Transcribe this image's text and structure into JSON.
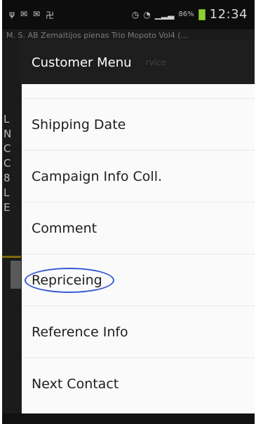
{
  "status_bar": {
    "battery_percent": "86%",
    "time": "12:34",
    "left_icons": [
      "usb-icon",
      "email-icon",
      "email-icon",
      "notification-icon"
    ],
    "right_icons": [
      "alarm-icon",
      "wifi-icon",
      "signal-icon",
      "battery-icon"
    ]
  },
  "background": {
    "title": "M. S. AB Zemaitijos pienas Trio Mopoto Vol4 (...",
    "left_letters": [
      "L",
      "N",
      "C",
      "C",
      "8",
      "L",
      "E"
    ]
  },
  "dialog": {
    "title": "Customer Menu",
    "header_ghost_text": "rvice",
    "items": [
      {
        "label": "Shipping Date"
      },
      {
        "label": "Campaign Info Coll."
      },
      {
        "label": "Comment"
      },
      {
        "label": "Repriceing"
      },
      {
        "label": "Reference Info"
      },
      {
        "label": "Next Contact"
      }
    ]
  },
  "highlight_color": "#3657d6"
}
